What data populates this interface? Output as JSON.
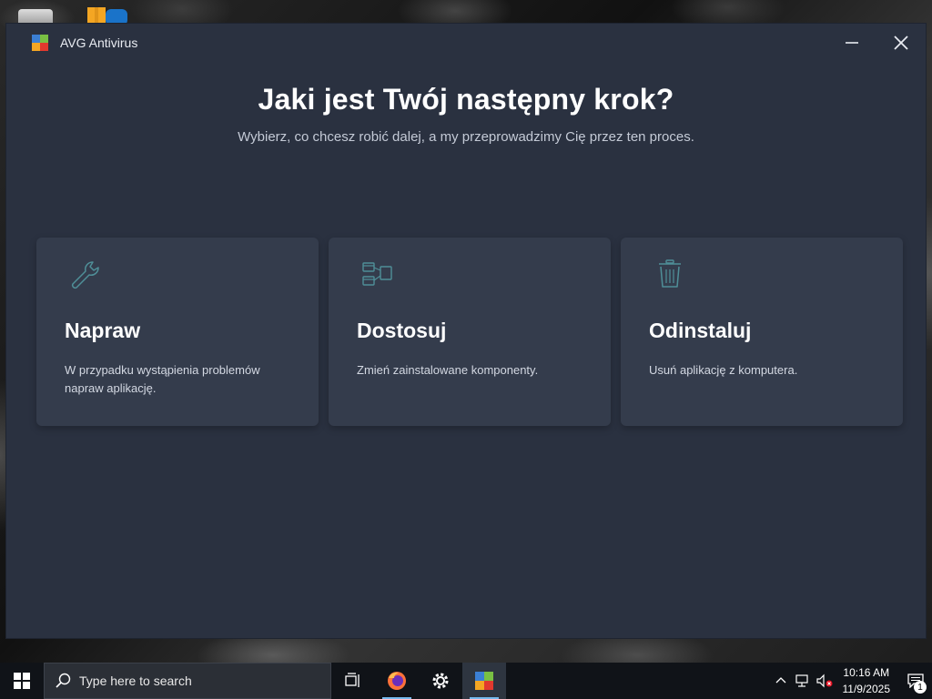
{
  "window": {
    "title": "AVG Antivirus",
    "minimize_icon": "minimize-icon",
    "close_icon": "close-icon"
  },
  "main": {
    "heading": "Jaki jest Twój następny krok?",
    "subheading": "Wybierz, co chcesz robić dalej, a my przeprowadzimy Cię przez ten proces.",
    "cards": [
      {
        "icon": "wrench-icon",
        "title": "Napraw",
        "description": "W przypadku wystąpienia problemów napraw aplikację."
      },
      {
        "icon": "components-icon",
        "title": "Dostosuj",
        "description": "Zmień zainstalowane komponenty."
      },
      {
        "icon": "trash-icon",
        "title": "Odinstaluj",
        "description": "Usuń aplikację z komputera."
      }
    ]
  },
  "taskbar": {
    "search_placeholder": "Type here to search",
    "time": "10:16 AM",
    "date": "11/9/2025",
    "notification_count": "1"
  },
  "colors": {
    "window_bg": "#2a3140",
    "card_bg": "#343c4c",
    "icon_stroke": "#4f8f98",
    "taskbar_bg": "#101318"
  }
}
